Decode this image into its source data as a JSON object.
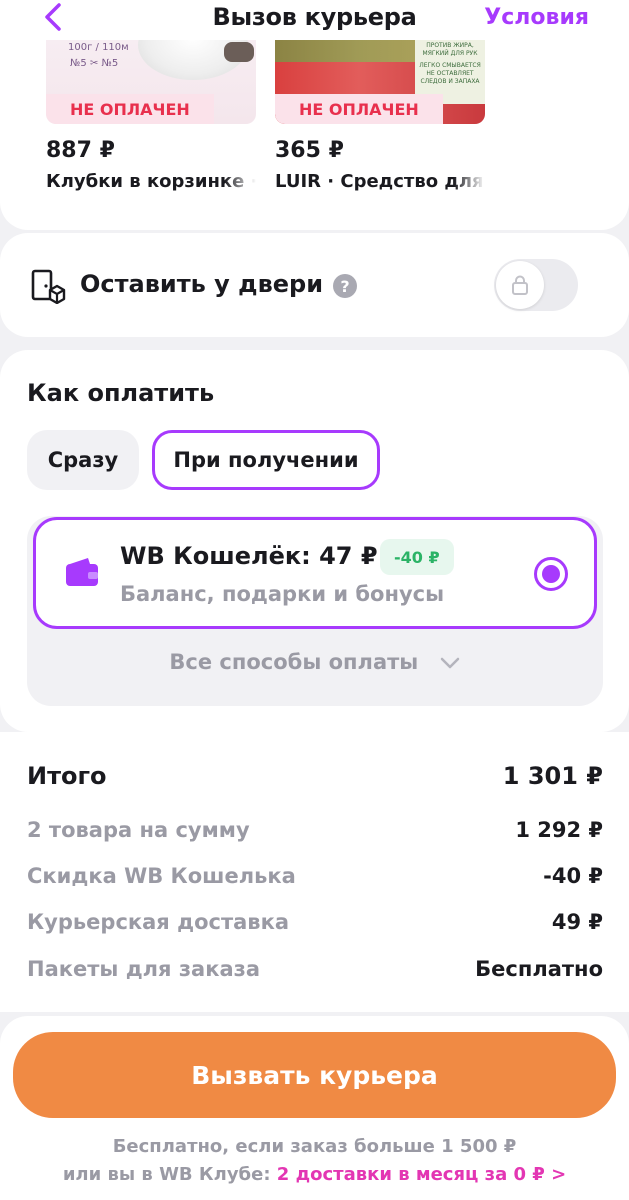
{
  "header": {
    "title": "Вызов курьера",
    "terms_link": "Условия",
    "back_icon": "chevron-left-icon"
  },
  "products": [
    {
      "badge": "НЕ ОПЛАЧЕН",
      "price": "887 ₽",
      "name": "Клубки в корзинке · ",
      "image_meta_1": "100г / 110м",
      "image_meta_2": "№5 ✂ №5"
    },
    {
      "badge": "НЕ ОПЛАЧЕН",
      "price": "365 ₽",
      "name": "LUIR · Средство для",
      "image_meta_1": "ПРОТИВ ЖИРА, МЯГКИЙ ДЛЯ РУК",
      "image_meta_2": "ЛЕГКО СМЫВАЕТСЯ НЕ ОСТАВЛЯЕТ СЛЕДОВ И ЗАПАХА"
    }
  ],
  "door": {
    "label": "Оставить у двери",
    "help": "?",
    "toggle_on": false
  },
  "payment": {
    "title": "Как оплатить",
    "tabs": [
      {
        "label": "Сразу",
        "selected": false
      },
      {
        "label": "При получении",
        "selected": true
      }
    ],
    "wallet": {
      "title": "WB Кошелёк: 47 ₽",
      "discount": "-40 ₽",
      "subtitle": "Баланс, подарки и бонусы",
      "selected": true
    },
    "all_methods": "Все способы оплаты"
  },
  "totals": {
    "total_label": "Итого",
    "total_value": "1 301 ₽",
    "rows": [
      {
        "label": "2 товара на сумму",
        "value": "1 292 ₽"
      },
      {
        "label": "Скидка WB Кошелька",
        "value": "-40 ₽"
      },
      {
        "label": "Курьерская доставка",
        "value": "49 ₽"
      },
      {
        "label": "Пакеты для заказа",
        "value": "Бесплатно"
      }
    ]
  },
  "bottom": {
    "cta": "Вызвать курьера",
    "note_line1": "Бесплатно, если заказ больше 1 500 ₽",
    "note_line2_prefix": "или вы в WB Клубе: ",
    "note_line2_link": "2 доставки в месяц за 0 ₽ >"
  },
  "colors": {
    "accent": "#a73afd",
    "cta": "#f08a44",
    "unpaid": "#e8304d",
    "discount": "#2bb366",
    "link": "#e336b3"
  }
}
